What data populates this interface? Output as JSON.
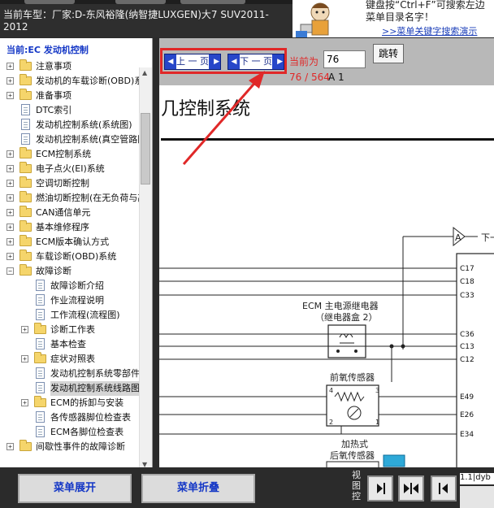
{
  "header": {
    "car_model": "当前车型：厂家:D-东风裕隆(纳智捷LUXGEN)大7 SUV2011-2012"
  },
  "tip": {
    "text": "键盘按“Ctrl+F”可搜索左边菜单目录名字！",
    "link": ">>菜单关键字搜索演示"
  },
  "tree": {
    "title": "当前:EC 发动机控制",
    "items": [
      {
        "label": "注意事项",
        "type": "folder",
        "level": 0,
        "toggle": "+"
      },
      {
        "label": "发动机的车载诊断(OBD)系统",
        "type": "folder",
        "level": 0,
        "toggle": "+"
      },
      {
        "label": "准备事项",
        "type": "folder",
        "level": 0,
        "toggle": "+"
      },
      {
        "label": "DTC索引",
        "type": "page",
        "level": 0,
        "toggle": ""
      },
      {
        "label": "发动机控制系统(系统图)",
        "type": "page",
        "level": 0,
        "toggle": ""
      },
      {
        "label": "发动机控制系统(真空管路图)",
        "type": "page",
        "level": 0,
        "toggle": ""
      },
      {
        "label": "ECM控制系统",
        "type": "folder",
        "level": 0,
        "toggle": "+"
      },
      {
        "label": "电子点火(EI)系统",
        "type": "folder",
        "level": 0,
        "toggle": "+"
      },
      {
        "label": "空调切断控制",
        "type": "folder",
        "level": 0,
        "toggle": "+"
      },
      {
        "label": "燃油切断控制(在无负荷与高转速下)",
        "type": "folder",
        "level": 0,
        "toggle": "+"
      },
      {
        "label": "CAN通信单元",
        "type": "folder",
        "level": 0,
        "toggle": "+"
      },
      {
        "label": "基本维修程序",
        "type": "folder",
        "level": 0,
        "toggle": "+"
      },
      {
        "label": "ECM版本确认方式",
        "type": "folder",
        "level": 0,
        "toggle": "+"
      },
      {
        "label": "车载诊断(OBD)系统",
        "type": "folder",
        "level": 0,
        "toggle": "+"
      },
      {
        "label": "故障诊断",
        "type": "folder",
        "level": 0,
        "toggle": "-"
      },
      {
        "label": "故障诊断介绍",
        "type": "page",
        "level": 1,
        "toggle": ""
      },
      {
        "label": "作业流程说明",
        "type": "page",
        "level": 1,
        "toggle": ""
      },
      {
        "label": "工作流程(流程图)",
        "type": "page",
        "level": 1,
        "toggle": ""
      },
      {
        "label": "诊断工作表",
        "type": "folder",
        "level": 1,
        "toggle": "+"
      },
      {
        "label": "基本检查",
        "type": "page",
        "level": 1,
        "toggle": ""
      },
      {
        "label": "症状对照表",
        "type": "folder",
        "level": 1,
        "toggle": "+"
      },
      {
        "label": "发动机控制系统零部件位置",
        "type": "page",
        "level": 1,
        "toggle": ""
      },
      {
        "label": "发动机控制系统线路图",
        "type": "page",
        "level": 1,
        "toggle": "",
        "selected": true
      },
      {
        "label": "ECM的拆卸与安装",
        "type": "folder",
        "level": 1,
        "toggle": "+"
      },
      {
        "label": "各传感器脚位检查表",
        "type": "page",
        "level": 1,
        "toggle": ""
      },
      {
        "label": "ECM各脚位检查表",
        "type": "page",
        "level": 1,
        "toggle": ""
      },
      {
        "label": "间歇性事件的故障诊断",
        "type": "folder",
        "level": 0,
        "toggle": "+"
      }
    ]
  },
  "nav": {
    "prev_label": "上 一 页",
    "next_label": "下 一 页",
    "current_label": "当前为",
    "page_value": "76",
    "jump_label": "跳转",
    "page_count": "76 / 564",
    "page_letter": "A 1"
  },
  "document": {
    "title": "几控制系统",
    "diagram": {
      "connector_a": "A",
      "connector_a_suffix": "下一",
      "pins_top": [
        "C17",
        "C18",
        "C33"
      ],
      "relay_label_1": "ECM 主电源继电器",
      "relay_label_2": "（继电器盒 2）",
      "pins_mid": [
        "C36",
        "C13",
        "C12"
      ],
      "sensor_label": "前氧传感器",
      "pin_num_4": "4",
      "pin_num_3": "3",
      "pin_num_2": "2",
      "pin_num_1": "1",
      "pins_sensor": [
        "E49",
        "E26",
        "E34"
      ],
      "heater_label_1": "加热式",
      "heater_label_2": "后氧传感器"
    }
  },
  "bottom": {
    "expand_label": "菜单展开",
    "collapse_label": "菜单折叠",
    "view_label": "视图控",
    "corner_text": "1.1|dyb"
  },
  "colors": {
    "accent_red": "#e02828",
    "nav_blue": "#2746c9",
    "tree_title_blue": "#1437c6",
    "folder_yellow": "#f5d56b"
  }
}
